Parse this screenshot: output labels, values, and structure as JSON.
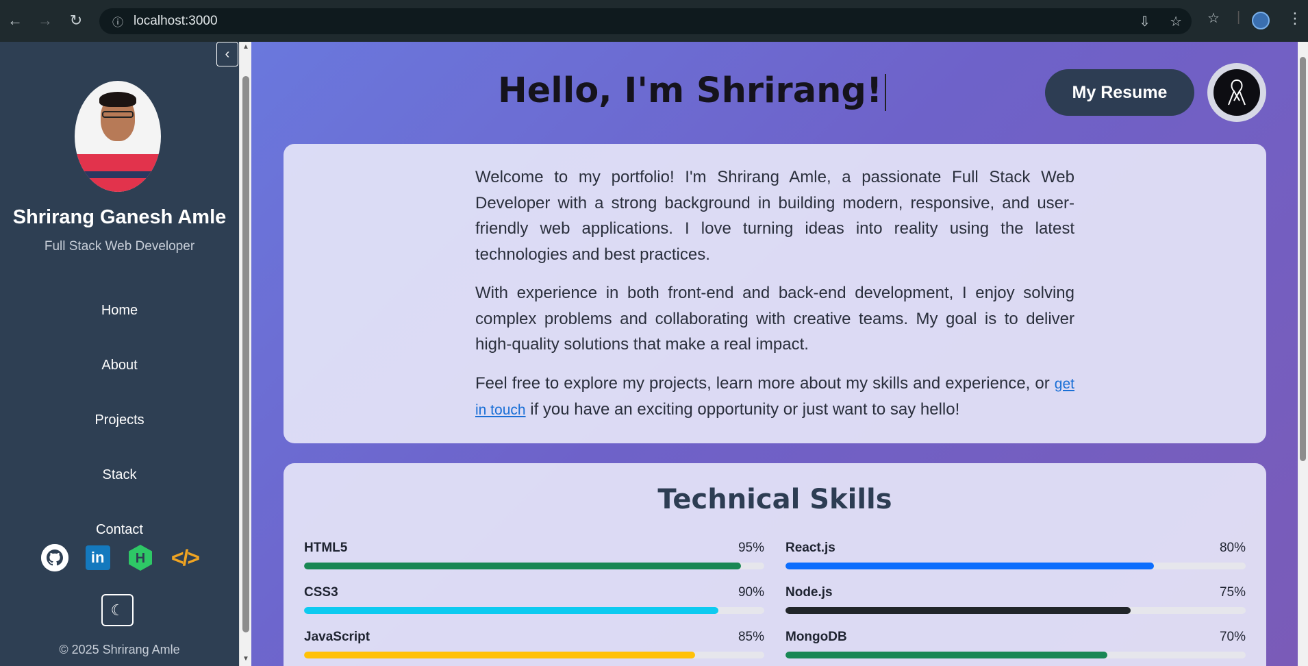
{
  "browser": {
    "url": "localhost:3000"
  },
  "sidebar": {
    "name": "Shrirang Ganesh Amle",
    "role": "Full Stack Web Developer",
    "nav": [
      {
        "label": "Home"
      },
      {
        "label": "About"
      },
      {
        "label": "Projects"
      },
      {
        "label": "Stack"
      },
      {
        "label": "Contact"
      }
    ],
    "socials": [
      "github-icon",
      "linkedin-icon",
      "hackerrank-icon",
      "code-icon"
    ],
    "copyright": "© 2025 Shrirang Amle"
  },
  "header": {
    "title": "Hello, I'm Shrirang!",
    "resume_label": "My Resume"
  },
  "intro": {
    "p1": "Welcome to my portfolio! I'm Shrirang Amle, a passionate Full Stack Web Developer with a strong background in building modern, responsive, and user-friendly web applications. I love turning ideas into reality using the latest technologies and best practices.",
    "p2": "With experience in both front-end and back-end development, I enjoy solving complex problems and collaborating with creative teams. My goal is to deliver high-quality solutions that make a real impact.",
    "p3_before": "Feel free to explore my projects, learn more about my skills and experience, or ",
    "p3_link": "get in touch",
    "p3_after": " if you have an exciting opportunity or just want to say hello!"
  },
  "skills": {
    "title": "Technical Skills",
    "items": [
      {
        "name": "HTML5",
        "percent": "95%",
        "value": 95,
        "color": "#198754"
      },
      {
        "name": "React.js",
        "percent": "80%",
        "value": 80,
        "color": "#0d6efd"
      },
      {
        "name": "CSS3",
        "percent": "90%",
        "value": 90,
        "color": "#0dcaf0"
      },
      {
        "name": "Node.js",
        "percent": "75%",
        "value": 75,
        "color": "#212529"
      },
      {
        "name": "JavaScript",
        "percent": "85%",
        "value": 85,
        "color": "#ffc107"
      },
      {
        "name": "MongoDB",
        "percent": "70%",
        "value": 70,
        "color": "#198754"
      }
    ]
  }
}
